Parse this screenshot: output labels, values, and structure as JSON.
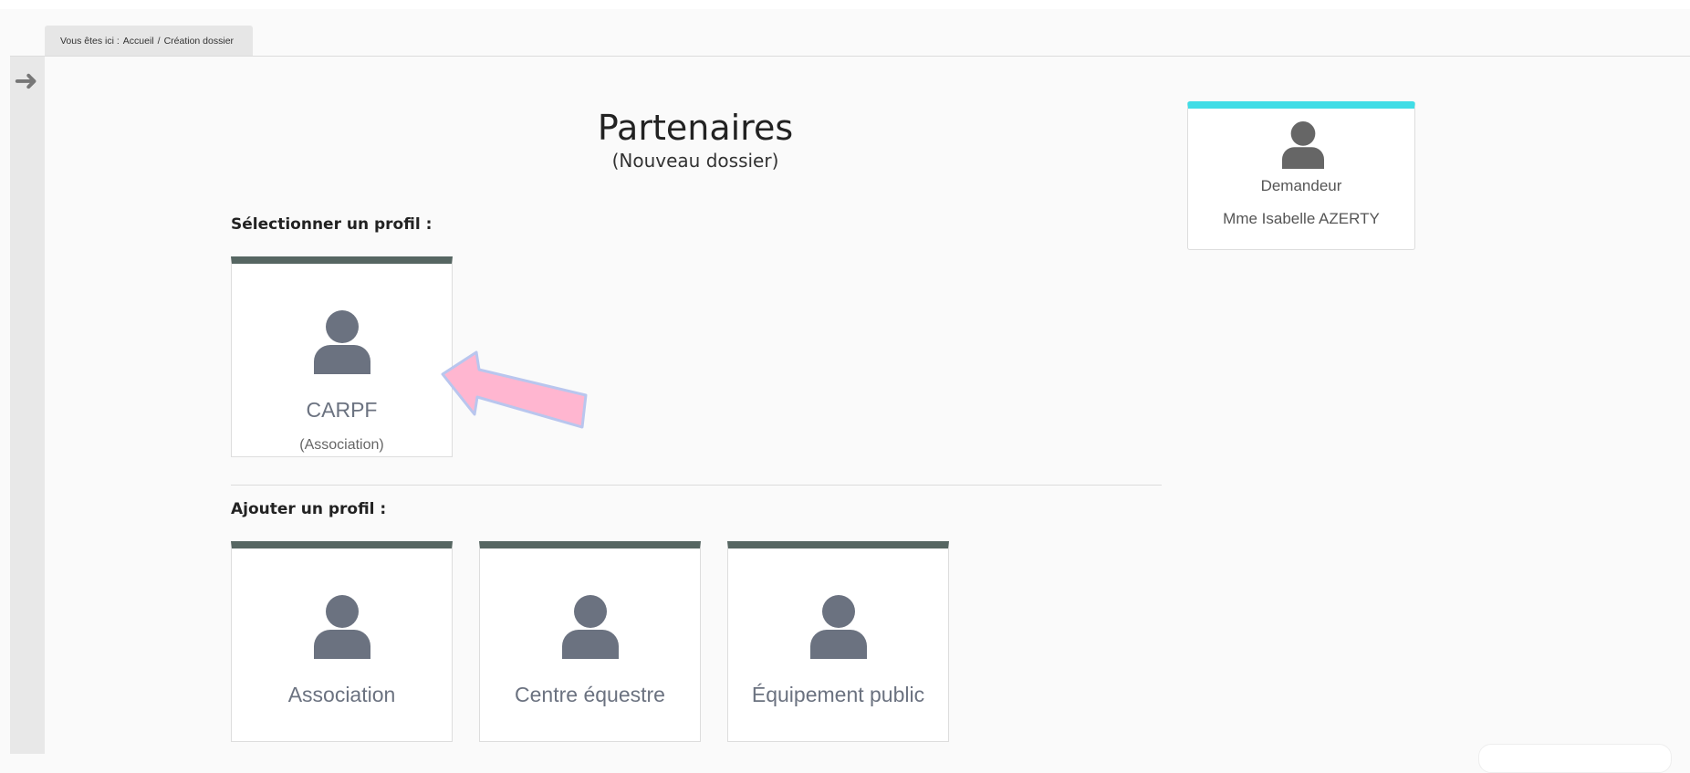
{
  "breadcrumb": {
    "prefix": "Vous êtes ici :",
    "home": "Accueil",
    "separator": "/",
    "current": "Création dossier"
  },
  "page": {
    "title": "Partenaires",
    "subtitle": "(Nouveau dossier)"
  },
  "select_section": {
    "label": "Sélectionner un profil :",
    "profiles": [
      {
        "name": "CARPF",
        "type": "(Association)"
      }
    ]
  },
  "add_section": {
    "label": "Ajouter un profil :",
    "options": [
      {
        "name": "Association"
      },
      {
        "name": "Centre équestre"
      },
      {
        "name": "Équipement public"
      }
    ]
  },
  "requester": {
    "role": "Demandeur",
    "name": "Mme Isabelle AZERTY"
  },
  "colors": {
    "card_top": "#566662",
    "requester_top": "#40dde6",
    "pointer_arrow": "#ffb6d0",
    "icon": "#6b7280"
  },
  "icons": {
    "sidebar_toggle": "arrow-right-icon",
    "profile": "person-icon"
  }
}
